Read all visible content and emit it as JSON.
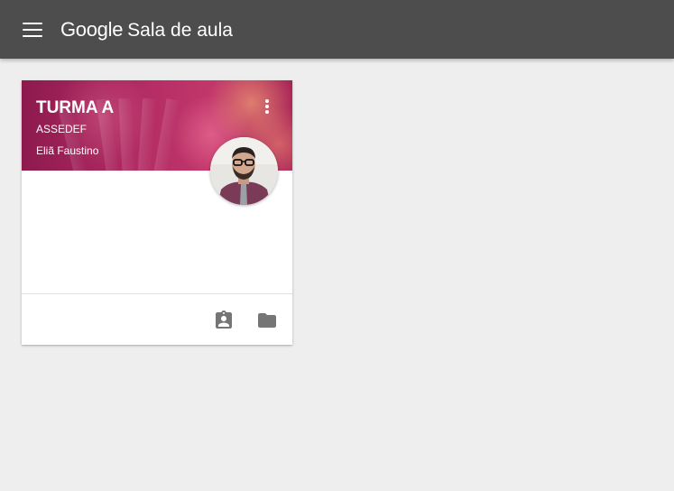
{
  "app": {
    "brand_google": "Google",
    "brand_product": "Sala de aula"
  },
  "icons": {
    "menu": "menu-icon",
    "more": "more-vert-icon",
    "assignment": "assignment-ind-icon",
    "folder": "folder-icon"
  },
  "colors": {
    "topbar": "#4d4d4d",
    "background": "#eeeeee",
    "card_header": "#b02a62",
    "footer_icon": "#757575"
  },
  "classes": [
    {
      "name": "TURMA A",
      "section": "ASSEDEF",
      "teacher": "Eliã Faustino"
    }
  ]
}
